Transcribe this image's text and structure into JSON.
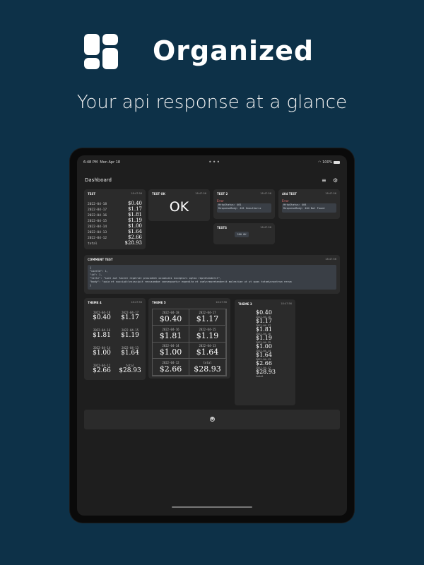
{
  "hero": {
    "brand": "Organized",
    "tagline": "Your api response at a glance"
  },
  "status_bar": {
    "time": "6:48 PM",
    "date": "Mon Apr 18",
    "battery": "100%"
  },
  "nav": {
    "title": "Dashboard",
    "icons": [
      "sort-icon",
      "gear-icon"
    ]
  },
  "cards": {
    "test": {
      "title": "TEST",
      "time": "18:47:56",
      "rows": [
        {
          "date": "2022-04-18",
          "value": "$0.40"
        },
        {
          "date": "2022-04-17",
          "value": "$1.17"
        },
        {
          "date": "2022-04-16",
          "value": "$1.81"
        },
        {
          "date": "2022-04-15",
          "value": "$1.19"
        },
        {
          "date": "2022-04-14",
          "value": "$1.00"
        },
        {
          "date": "2022-04-13",
          "value": "$1.64"
        },
        {
          "date": "2022-04-12",
          "value": "$2.66"
        },
        {
          "date": "total",
          "value": "$28.93"
        }
      ]
    },
    "test_ok": {
      "title": "TEST OK",
      "time": "18:47:56",
      "value": "OK"
    },
    "test2": {
      "title": "TEST 2",
      "time": "18:47:56",
      "error_label": "Error",
      "lines": [
        "HttpStatus: 401",
        "ResponseBody: 401 Unauthoriz"
      ]
    },
    "test_404": {
      "title": "404 TEST",
      "time": "18:47:56",
      "error_label": "Error",
      "lines": [
        "HttpStatus: 404",
        "ResponseBody: 404 Not Found"
      ]
    },
    "tests": {
      "title": "TESTS",
      "time": "18:47:56",
      "value": "200 OK"
    },
    "comment_test": {
      "title": "COMMENT TEST",
      "time": "18:47:56",
      "lines": [
        "{",
        "  \"userId\": 1,",
        "  \"id\": 1,",
        "  \"title\": \"sunt aut facere repellat provident occaecati excepturi optio reprehenderit\",",
        "  \"body\": \"quia et suscipit\\nsuscipit recusandae consequuntur expedita et cum\\nreprehenderit molestiae ut ut quas totam\\nnostrum rerum",
        "}"
      ]
    },
    "theme4": {
      "title": "THEME 4",
      "time": "18:47:56",
      "cells": [
        {
          "date": "2022-04-18",
          "value": "$0.40"
        },
        {
          "date": "2022-04-17",
          "value": "$1.17"
        },
        {
          "date": "2022-04-16",
          "value": "$1.81"
        },
        {
          "date": "2022-04-15",
          "value": "$1.19"
        },
        {
          "date": "2022-04-14",
          "value": "$1.00"
        },
        {
          "date": "2022-04-13",
          "value": "$1.64"
        },
        {
          "date": "2022-04-12",
          "value": "$2.66"
        },
        {
          "date": "total",
          "value": "$28.93"
        }
      ]
    },
    "theme5": {
      "title": "THEME 5",
      "time": "18:47:56",
      "cells": [
        {
          "date": "2022-04-18",
          "value": "$0.40"
        },
        {
          "date": "2022-04-17",
          "value": "$1.17"
        },
        {
          "date": "2022-04-16",
          "value": "$1.81"
        },
        {
          "date": "2022-04-15",
          "value": "$1.19"
        },
        {
          "date": "2022-04-14",
          "value": "$1.00"
        },
        {
          "date": "2022-04-13",
          "value": "$1.64"
        },
        {
          "date": "2022-04-12",
          "value": "$2.66"
        },
        {
          "date": "total",
          "value": "$28.93"
        }
      ]
    },
    "theme3": {
      "title": "THEME 3",
      "time": "18:47:56",
      "items": [
        {
          "value": "$0.40",
          "date": "2022-04-18"
        },
        {
          "value": "$1.17",
          "date": "2022-04-17"
        },
        {
          "value": "$1.81",
          "date": "2022-04-16"
        },
        {
          "value": "$1.19",
          "date": "2022-04-15"
        },
        {
          "value": "$1.00",
          "date": "2022-04-14"
        },
        {
          "value": "$1.64",
          "date": "2022-04-13"
        },
        {
          "value": "$2.66",
          "date": "2022-04-12"
        },
        {
          "value": "$28.93",
          "date": "total"
        }
      ]
    }
  },
  "colors": {
    "background": "#0d3148",
    "card": "#2b2b2b",
    "screen": "#1e1e1e",
    "error": "#e07070"
  }
}
